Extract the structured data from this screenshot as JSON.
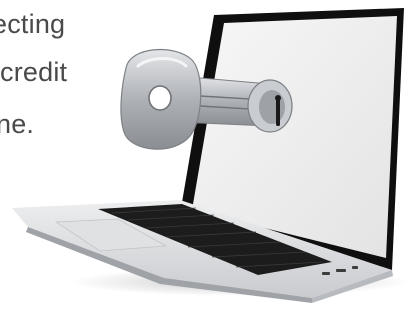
{
  "text_fragment": {
    "line1": "ecting",
    "line2": "credit",
    "line3": "ne."
  },
  "colors": {
    "text": "#4a4a4a",
    "laptop_body": "#d9dadc",
    "keyboard": "#1c1c1c",
    "screen_bezel": "#0f0f0f",
    "key_metal": "#b9bcc1"
  },
  "illustration": {
    "subject": "laptop-with-key-inserted-in-screen"
  }
}
